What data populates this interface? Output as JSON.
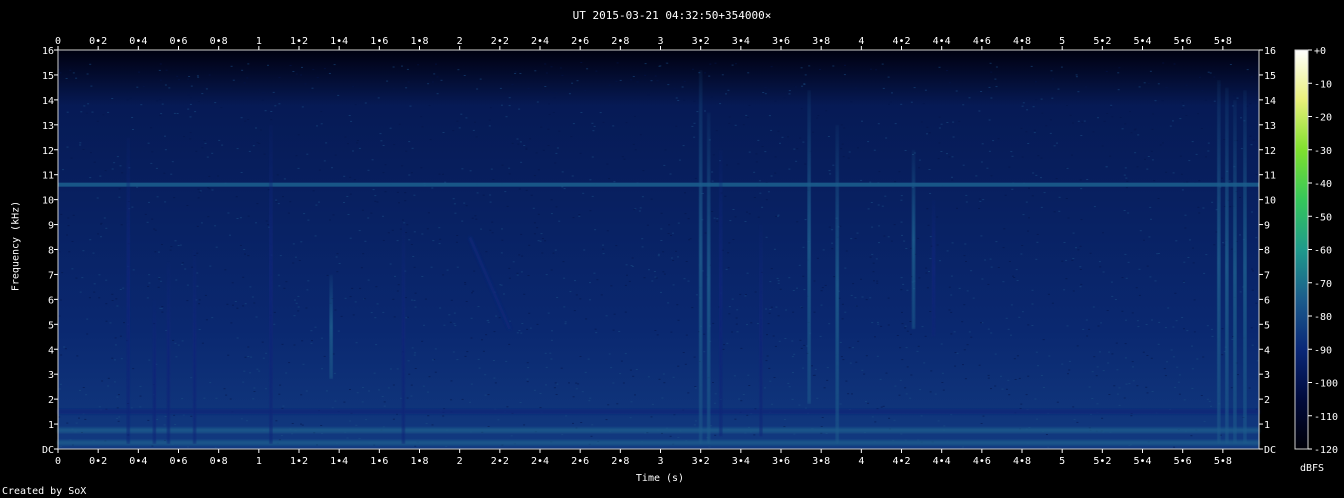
{
  "chart_data": {
    "type": "heatmap",
    "title": "UT 2015-03-21 04:32:50+354000×",
    "xlabel": "Time (s)",
    "ylabel": "Frequency (kHz)",
    "footer": "Created by SoX",
    "xlim": [
      0,
      5.98
    ],
    "ylim": [
      0,
      16
    ],
    "x_ticks": [
      {
        "v": 0,
        "label": "0"
      },
      {
        "v": 0.2,
        "label": "0•2"
      },
      {
        "v": 0.4,
        "label": "0•4"
      },
      {
        "v": 0.6,
        "label": "0•6"
      },
      {
        "v": 0.8,
        "label": "0•8"
      },
      {
        "v": 1,
        "label": "1"
      },
      {
        "v": 1.2,
        "label": "1•2"
      },
      {
        "v": 1.4,
        "label": "1•4"
      },
      {
        "v": 1.6,
        "label": "1•6"
      },
      {
        "v": 1.8,
        "label": "1•8"
      },
      {
        "v": 2,
        "label": "2"
      },
      {
        "v": 2.2,
        "label": "2•2"
      },
      {
        "v": 2.4,
        "label": "2•4"
      },
      {
        "v": 2.6,
        "label": "2•6"
      },
      {
        "v": 2.8,
        "label": "2•8"
      },
      {
        "v": 3,
        "label": "3"
      },
      {
        "v": 3.2,
        "label": "3•2"
      },
      {
        "v": 3.4,
        "label": "3•4"
      },
      {
        "v": 3.6,
        "label": "3•6"
      },
      {
        "v": 3.8,
        "label": "3•8"
      },
      {
        "v": 4,
        "label": "4"
      },
      {
        "v": 4.2,
        "label": "4•2"
      },
      {
        "v": 4.4,
        "label": "4•4"
      },
      {
        "v": 4.6,
        "label": "4•6"
      },
      {
        "v": 4.8,
        "label": "4•8"
      },
      {
        "v": 5,
        "label": "5"
      },
      {
        "v": 5.2,
        "label": "5•2"
      },
      {
        "v": 5.4,
        "label": "5•4"
      },
      {
        "v": 5.6,
        "label": "5•6"
      },
      {
        "v": 5.8,
        "label": "5•8"
      }
    ],
    "y_ticks": [
      {
        "v": 0,
        "label": "DC"
      },
      {
        "v": 1,
        "label": "1"
      },
      {
        "v": 2,
        "label": "2"
      },
      {
        "v": 3,
        "label": "3"
      },
      {
        "v": 4,
        "label": "4"
      },
      {
        "v": 5,
        "label": "5"
      },
      {
        "v": 6,
        "label": "6"
      },
      {
        "v": 7,
        "label": "7"
      },
      {
        "v": 8,
        "label": "8"
      },
      {
        "v": 9,
        "label": "9"
      },
      {
        "v": 10,
        "label": "10"
      },
      {
        "v": 11,
        "label": "11"
      },
      {
        "v": 12,
        "label": "12"
      },
      {
        "v": 13,
        "label": "13"
      },
      {
        "v": 14,
        "label": "14"
      },
      {
        "v": 15,
        "label": "15"
      },
      {
        "v": 16,
        "label": "16"
      }
    ],
    "colorbar": {
      "unit": "dBFS",
      "range": [
        -120,
        0
      ],
      "ticks": [
        {
          "v": 0,
          "label": "+0"
        },
        {
          "v": -10,
          "label": "-10"
        },
        {
          "v": -20,
          "label": "-20"
        },
        {
          "v": -30,
          "label": "-30"
        },
        {
          "v": -40,
          "label": "-40"
        },
        {
          "v": -50,
          "label": "-50"
        },
        {
          "v": -60,
          "label": "-60"
        },
        {
          "v": -70,
          "label": "-70"
        },
        {
          "v": -80,
          "label": "-80"
        },
        {
          "v": -90,
          "label": "-90"
        },
        {
          "v": -100,
          "label": "-100"
        },
        {
          "v": -110,
          "label": "-110"
        },
        {
          "v": -120,
          "label": "-120"
        }
      ],
      "colors": [
        "#000008",
        "#000a3c",
        "#0a2878",
        "#1b5c8c",
        "#1f9a8c",
        "#35c75a",
        "#7fe02e",
        "#e9f07a",
        "#ffffff"
      ]
    },
    "background_level_db": -95,
    "tone_line": {
      "freq_khz": 10.6,
      "level_db": -80
    },
    "low_freq_bands": [
      {
        "freq_khz": 0.25,
        "level_db": -78
      },
      {
        "freq_khz": 0.75,
        "level_db": -82
      },
      {
        "freq_khz": 1.5,
        "level_db": -90
      }
    ],
    "events": [
      {
        "t": 0.35,
        "f_lo": 0.2,
        "f_hi": 12.5,
        "level_db": -85
      },
      {
        "t": 0.48,
        "f_lo": 0.2,
        "f_hi": 6,
        "level_db": -86
      },
      {
        "t": 0.55,
        "f_lo": 0.2,
        "f_hi": 7.5,
        "level_db": -84
      },
      {
        "t": 0.68,
        "f_lo": 0.2,
        "f_hi": 8,
        "level_db": -86
      },
      {
        "t": 1.06,
        "f_lo": 0.2,
        "f_hi": 13,
        "level_db": -84
      },
      {
        "t": 1.36,
        "f_lo": 2.8,
        "f_hi": 7,
        "level_db": -80
      },
      {
        "t": 1.72,
        "f_lo": 0.2,
        "f_hi": 9,
        "level_db": -86
      },
      {
        "t": 3.2,
        "f_lo": 0.2,
        "f_hi": 15.2,
        "level_db": -70
      },
      {
        "t": 3.24,
        "f_lo": 0.2,
        "f_hi": 13.5,
        "level_db": -78
      },
      {
        "t": 3.3,
        "f_lo": 0.5,
        "f_hi": 12,
        "level_db": -84
      },
      {
        "t": 3.5,
        "f_lo": 0.5,
        "f_hi": 9,
        "level_db": -86
      },
      {
        "t": 3.74,
        "f_lo": 1.8,
        "f_hi": 14.4,
        "level_db": -68
      },
      {
        "t": 3.88,
        "f_lo": 0.2,
        "f_hi": 13,
        "level_db": -82
      },
      {
        "t": 4.26,
        "f_lo": 4.8,
        "f_hi": 12,
        "level_db": -82
      },
      {
        "t": 4.36,
        "f_lo": 4.5,
        "f_hi": 10,
        "level_db": -86
      },
      {
        "t": 5.78,
        "f_lo": 0.2,
        "f_hi": 14.8,
        "level_db": -74
      },
      {
        "t": 5.82,
        "f_lo": 0.2,
        "f_hi": 14.5,
        "level_db": -72
      },
      {
        "t": 5.86,
        "f_lo": 0.2,
        "f_hi": 14,
        "level_db": -76
      },
      {
        "t": 5.91,
        "f_lo": 0.2,
        "f_hi": 14.4,
        "level_db": -78
      }
    ],
    "sweeps": [
      {
        "t_start": 2.05,
        "f_start": 8.5,
        "t_end": 2.25,
        "f_end": 4.8,
        "level_db": -84
      }
    ]
  }
}
